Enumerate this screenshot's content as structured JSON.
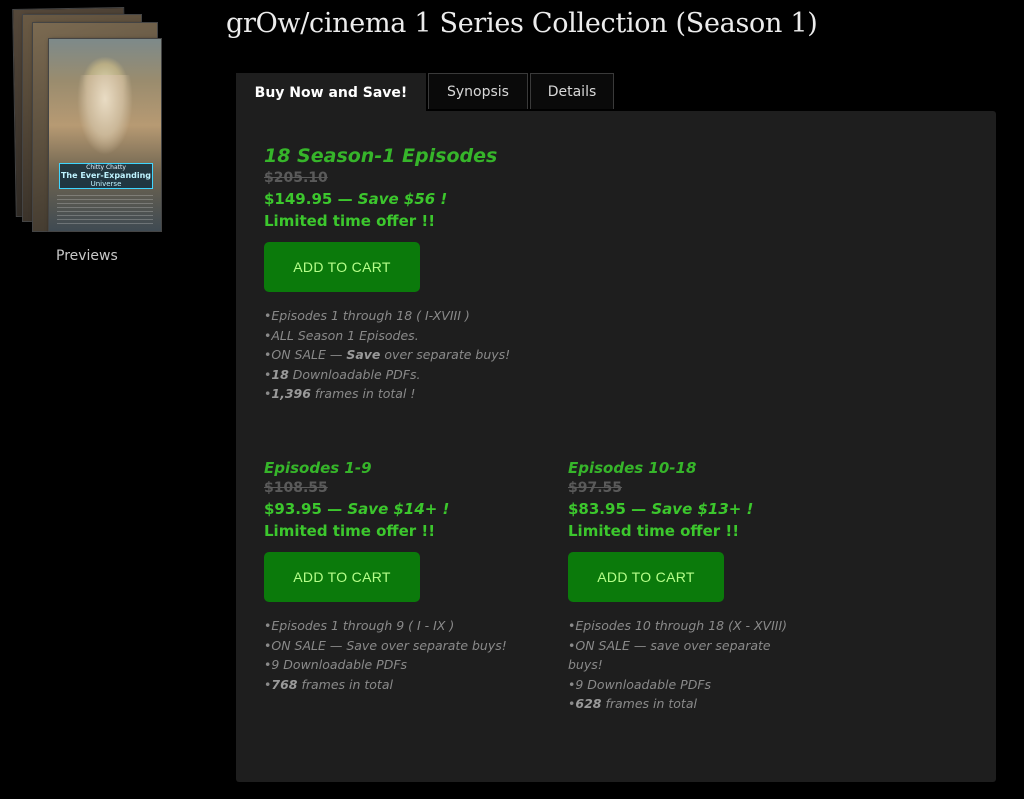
{
  "header": {
    "title": "grOw/cinema 1 Series Collection (Season 1)"
  },
  "sidebar": {
    "cover_top_text": "Chitty Chatty",
    "cover_title_main": "The Ever-Expanding",
    "cover_title_sub": "Universe",
    "previews_label": "Previews"
  },
  "tabs": [
    {
      "label": "Buy Now and Save!",
      "active": true
    },
    {
      "label": "Synopsis",
      "active": false
    },
    {
      "label": "Details",
      "active": false
    }
  ],
  "offers": {
    "full": {
      "title": "18 Season-1 Episodes",
      "old_price": "$205.10",
      "price": "$149.95",
      "save": "Save $56 !",
      "limited": "Limited time offer !!",
      "button": "ADD TO CART",
      "features": [
        {
          "pre": "Episodes 1 through 18 ( I-XVIII )",
          "bold": "",
          "post": ""
        },
        {
          "pre": "ALL Season 1 Episodes.",
          "bold": "",
          "post": ""
        },
        {
          "pre": "ON SALE — ",
          "bold": "Save",
          "post": " over separate buys!"
        },
        {
          "pre": "",
          "bold": "18",
          "post": " Downloadable PDFs."
        },
        {
          "pre": "",
          "bold": "1,396",
          "post": " frames in total !"
        }
      ]
    },
    "part1": {
      "title": "Episodes 1-9",
      "old_price": "$108.55",
      "price": "$93.95",
      "save": "Save $14+ !",
      "limited": "Limited time offer !!",
      "button": "ADD TO CART",
      "features": [
        {
          "pre": "Episodes 1 through 9 ( I - IX )",
          "bold": "",
          "post": ""
        },
        {
          "pre": "ON SALE — Save over separate buys!",
          "bold": "",
          "post": ""
        },
        {
          "pre": "9 Downloadable PDFs",
          "bold": "",
          "post": ""
        },
        {
          "pre": "",
          "bold": "768",
          "post": " frames in total"
        }
      ]
    },
    "part2": {
      "title": "Episodes 10-18",
      "old_price": "$97.55",
      "price": "$83.95",
      "save": "Save $13+ !",
      "limited": "Limited time offer !!",
      "button": "ADD TO CART",
      "features": [
        {
          "pre": "Episodes 10 through 18 (X - XVIII)",
          "bold": "",
          "post": ""
        },
        {
          "pre": "ON SALE — save over separate",
          "bold": "",
          "post": ""
        },
        {
          "pre": "buys!",
          "bold": "",
          "post": "",
          "nobullet": true
        },
        {
          "pre": "9 Downloadable PDFs",
          "bold": "",
          "post": ""
        },
        {
          "pre": "",
          "bold": "628",
          "post": " frames in total"
        }
      ]
    }
  },
  "colors": {
    "accent_green": "#3cc72d",
    "button_green": "#0b7a0b",
    "panel_bg": "#1e1e1e"
  }
}
